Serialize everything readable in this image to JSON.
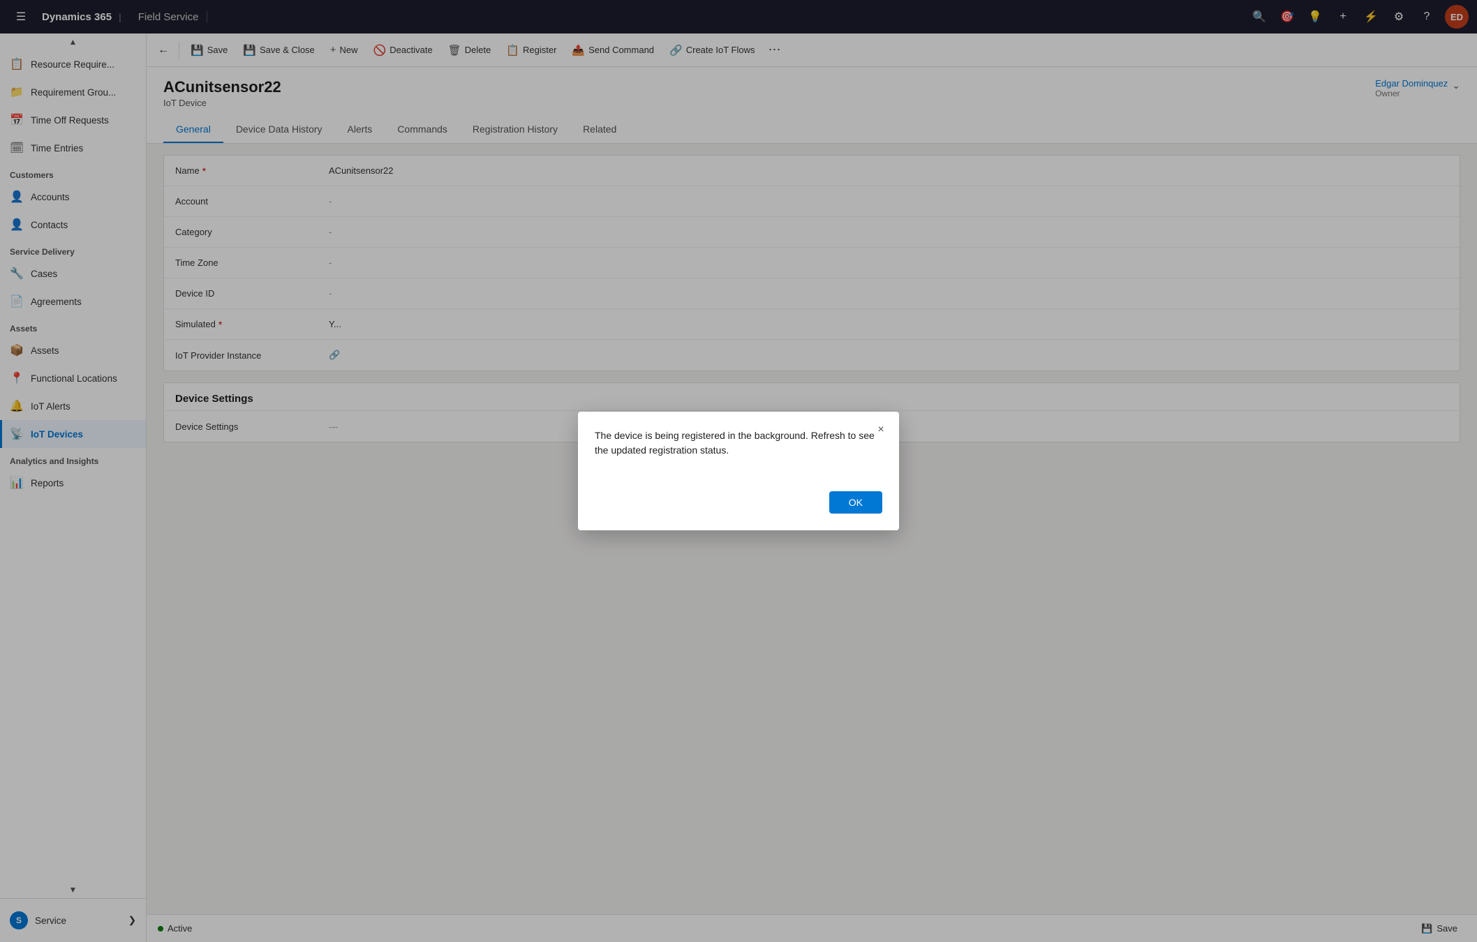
{
  "topNav": {
    "hamburger": "☰",
    "brand": "Dynamics 365",
    "separator": "|",
    "appName": "Field Service",
    "icons": [
      "🔍",
      "🎯",
      "💡",
      "+",
      "⚡",
      "⚙",
      "?"
    ],
    "avatar": "ED"
  },
  "sidebar": {
    "scrollUp": "▲",
    "scrollDown": "▼",
    "items": [
      {
        "id": "resource-req",
        "label": "Resource Require...",
        "icon": "📋"
      },
      {
        "id": "requirement-group",
        "label": "Requirement Grou...",
        "icon": "📁"
      },
      {
        "id": "time-off",
        "label": "Time Off Requests",
        "icon": "📅"
      },
      {
        "id": "time-entries",
        "label": "Time Entries",
        "icon": "🗓"
      }
    ],
    "sections": [
      {
        "title": "Customers",
        "items": [
          {
            "id": "accounts",
            "label": "Accounts",
            "icon": "👤"
          },
          {
            "id": "contacts",
            "label": "Contacts",
            "icon": "👤"
          }
        ]
      },
      {
        "title": "Service Delivery",
        "items": [
          {
            "id": "cases",
            "label": "Cases",
            "icon": "🔧"
          },
          {
            "id": "agreements",
            "label": "Agreements",
            "icon": "📄"
          }
        ]
      },
      {
        "title": "Assets",
        "items": [
          {
            "id": "assets",
            "label": "Assets",
            "icon": "📦"
          },
          {
            "id": "functional-locations",
            "label": "Functional Locations",
            "icon": "📍"
          },
          {
            "id": "iot-alerts",
            "label": "IoT Alerts",
            "icon": "🔔"
          },
          {
            "id": "iot-devices",
            "label": "IoT Devices",
            "icon": "📡",
            "active": true
          }
        ]
      },
      {
        "title": "Analytics and Insights",
        "items": [
          {
            "id": "reports",
            "label": "Reports",
            "icon": "📊"
          }
        ]
      }
    ],
    "bottom": {
      "label": "Service",
      "icon": "⚙",
      "chevron": "❯",
      "circleLabel": "S"
    }
  },
  "commandBar": {
    "back": "←",
    "buttons": [
      {
        "id": "save",
        "icon": "💾",
        "label": "Save"
      },
      {
        "id": "save-close",
        "icon": "💾",
        "label": "Save & Close"
      },
      {
        "id": "new",
        "icon": "+",
        "label": "New"
      },
      {
        "id": "deactivate",
        "icon": "🚫",
        "label": "Deactivate"
      },
      {
        "id": "delete",
        "icon": "🗑",
        "label": "Delete"
      },
      {
        "id": "register",
        "icon": "📋",
        "label": "Register"
      },
      {
        "id": "send-command",
        "icon": "📤",
        "label": "Send Command"
      },
      {
        "id": "create-iot-flows",
        "icon": "🔗",
        "label": "Create IoT Flows"
      }
    ],
    "more": "⋯"
  },
  "record": {
    "title": "ACunitsensor22",
    "subtitle": "IoT Device",
    "ownerName": "Edgar Dominquez",
    "ownerLabel": "Owner",
    "ownerChevron": "⌄",
    "tabs": [
      {
        "id": "general",
        "label": "General",
        "active": true
      },
      {
        "id": "device-data-history",
        "label": "Device Data History"
      },
      {
        "id": "alerts",
        "label": "Alerts"
      },
      {
        "id": "commands",
        "label": "Commands"
      },
      {
        "id": "registration-history",
        "label": "Registration History"
      },
      {
        "id": "related",
        "label": "Related"
      }
    ]
  },
  "form": {
    "fields": [
      {
        "label": "Name",
        "required": true,
        "value": "ACunitsensor22"
      },
      {
        "label": "Account",
        "required": false,
        "value": "-"
      },
      {
        "label": "Category",
        "required": false,
        "value": "-"
      },
      {
        "label": "Time Zone",
        "required": false,
        "value": "-"
      },
      {
        "label": "Device ID",
        "required": false,
        "value": "-"
      },
      {
        "label": "Simulated",
        "required": true,
        "value": "Y..."
      },
      {
        "label": "IoT Provider Instance",
        "required": false,
        "value": "🔗"
      }
    ],
    "deviceSettings": {
      "sectionTitle": "Device Settings",
      "fieldLabel": "Device Settings",
      "placeholder": "---"
    }
  },
  "dialog": {
    "message": "The device is being registered in the background. Refresh to see the updated registration status.",
    "closeIcon": "×",
    "okLabel": "OK"
  },
  "statusBar": {
    "statusLabel": "Active",
    "saveLabel": "Save",
    "saveIcon": "💾"
  }
}
